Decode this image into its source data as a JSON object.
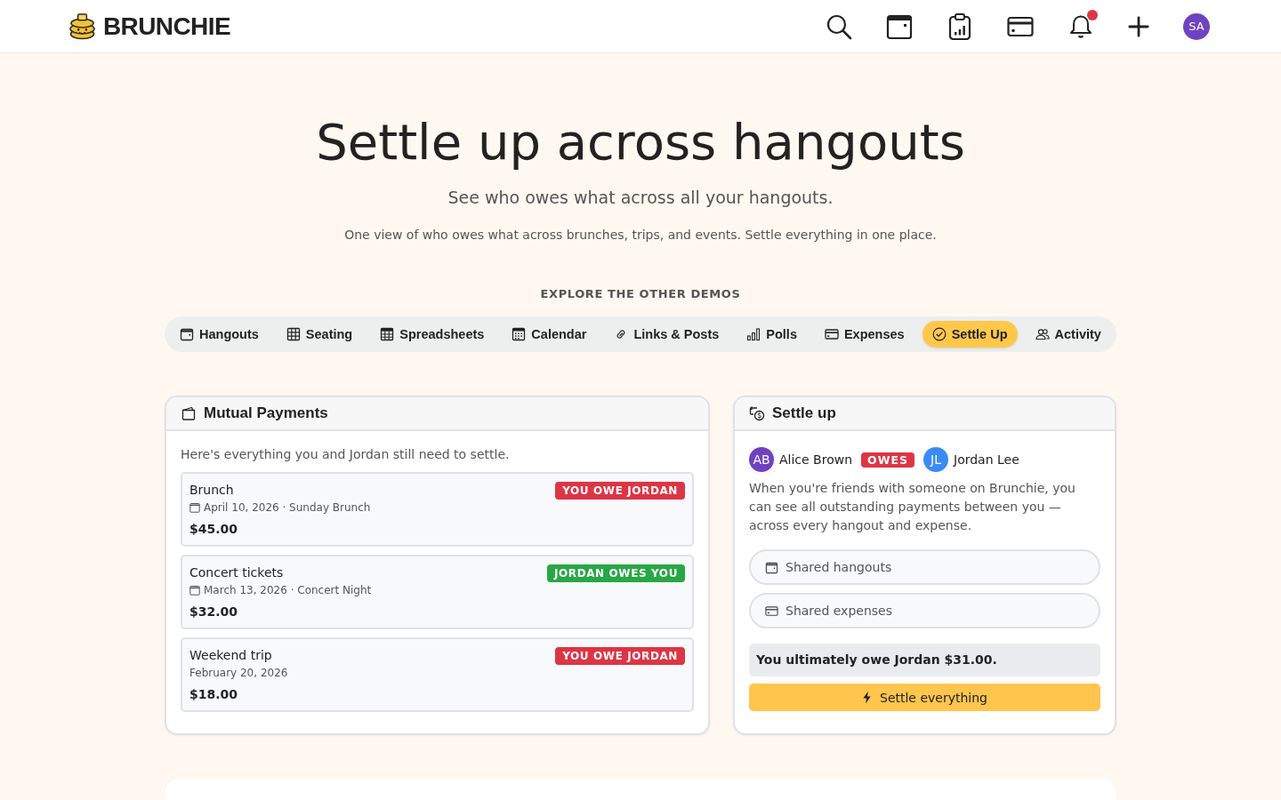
{
  "header": {
    "brand": "BRUNCHIE",
    "unread_notifications": true,
    "avatar": "SA"
  },
  "hero": {
    "title": "Settle up across hangouts",
    "subtitle": "See who owes what across all your hangouts.",
    "description": "One view of who owes what across brunches, trips, and events. Settle everything in one place."
  },
  "demos": {
    "heading": "EXPLORE THE OTHER DEMOS",
    "tabs": [
      {
        "label": "Hangouts",
        "selected": false
      },
      {
        "label": "Seating",
        "selected": false
      },
      {
        "label": "Spreadsheets",
        "selected": false
      },
      {
        "label": "Calendar",
        "selected": false
      },
      {
        "label": "Links & Posts",
        "selected": false
      },
      {
        "label": "Polls",
        "selected": false
      },
      {
        "label": "Expenses",
        "selected": false
      },
      {
        "label": "Settle Up",
        "selected": true
      },
      {
        "label": "Activity",
        "selected": false
      }
    ]
  },
  "mutual_payments": {
    "title": "Mutual Payments",
    "intro": "Here's everything you and Jordan still need to settle.",
    "payments": [
      {
        "title": "Brunch",
        "meta": "April 10, 2026 · Sunday Brunch",
        "linked_hangout": true,
        "amount": "$45.00",
        "badge": {
          "text": "YOU OWE JORDAN",
          "color": "#dc3545"
        }
      },
      {
        "title": "Concert tickets",
        "meta": "March 13, 2026 · Concert Night",
        "linked_hangout": true,
        "amount": "$32.00",
        "badge": {
          "text": "JORDAN OWES YOU",
          "color": "#28a745"
        }
      },
      {
        "title": "Weekend trip",
        "meta": "February 20, 2026",
        "linked_hangout": false,
        "amount": "$18.00",
        "badge": {
          "text": "YOU OWE JORDAN",
          "color": "#dc3545"
        }
      }
    ]
  },
  "settle_up": {
    "title": "Settle up",
    "from": {
      "initials": "AB",
      "name": "Alice Brown",
      "color": "#6f42c1"
    },
    "relation": "OWES",
    "to": {
      "initials": "JL",
      "name": "Jordan Lee",
      "color": "#3b8bf5"
    },
    "description": "When you're friends with someone on Brunchie, you can see all outstanding payments between you — across every hangout and expense.",
    "links": [
      "Shared hangouts",
      "Shared expenses"
    ],
    "summary": "You ultimately owe Jordan $31.00.",
    "button": "Settle everything"
  }
}
